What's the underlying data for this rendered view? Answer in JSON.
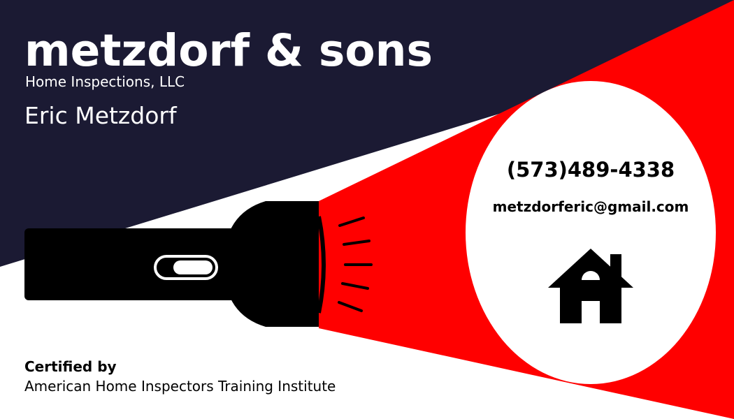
{
  "company": {
    "name": "metzdorf & sons",
    "subtitle": "Home Inspections, LLC",
    "person": "Eric Metzdorf"
  },
  "contact": {
    "phone": "(573)489-4338",
    "email": "metzdorferic@gmail.com"
  },
  "certification": {
    "label": "Certified by",
    "organization": "American Home Inspectors Training Institute"
  },
  "icons": [
    "flashlight-icon",
    "house-icon"
  ],
  "colors": {
    "navy": "#1b1a33",
    "beam": "#ff0000",
    "flashlight": "#000000",
    "text_light": "#ffffff",
    "text_dark": "#000000"
  }
}
